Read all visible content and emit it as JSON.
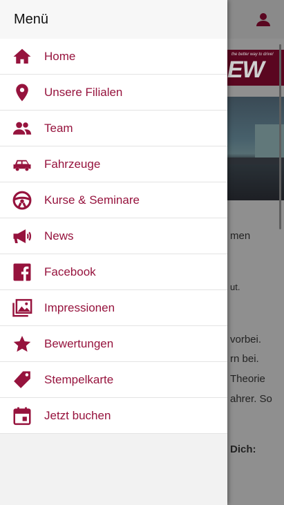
{
  "colors": {
    "accent": "#96133d",
    "drawer_bg": "#f2f2f2",
    "overlay": "#8f8f8f"
  },
  "drawer": {
    "title": "Menü",
    "items": [
      {
        "label": "Home",
        "icon": "home-icon"
      },
      {
        "label": "Unsere Filialen",
        "icon": "location-pin-icon"
      },
      {
        "label": "Team",
        "icon": "people-icon"
      },
      {
        "label": "Fahrzeuge",
        "icon": "car-icon"
      },
      {
        "label": "Kurse & Seminare",
        "icon": "steering-wheel-icon"
      },
      {
        "label": "News",
        "icon": "megaphone-icon"
      },
      {
        "label": "Facebook",
        "icon": "facebook-icon"
      },
      {
        "label": "Impressionen",
        "icon": "photos-icon"
      },
      {
        "label": "Bewertungen",
        "icon": "star-icon"
      },
      {
        "label": "Stempelkarte",
        "icon": "tag-icon"
      },
      {
        "label": "Jetzt buchen",
        "icon": "calendar-icon"
      }
    ]
  },
  "background": {
    "banner_slogan": "the better way to drive!",
    "banner_text": "EW",
    "lines": [
      "men",
      "ut.",
      "vorbei.",
      "rn bei.",
      "Theorie",
      "ahrer. So",
      "Dich:"
    ]
  }
}
